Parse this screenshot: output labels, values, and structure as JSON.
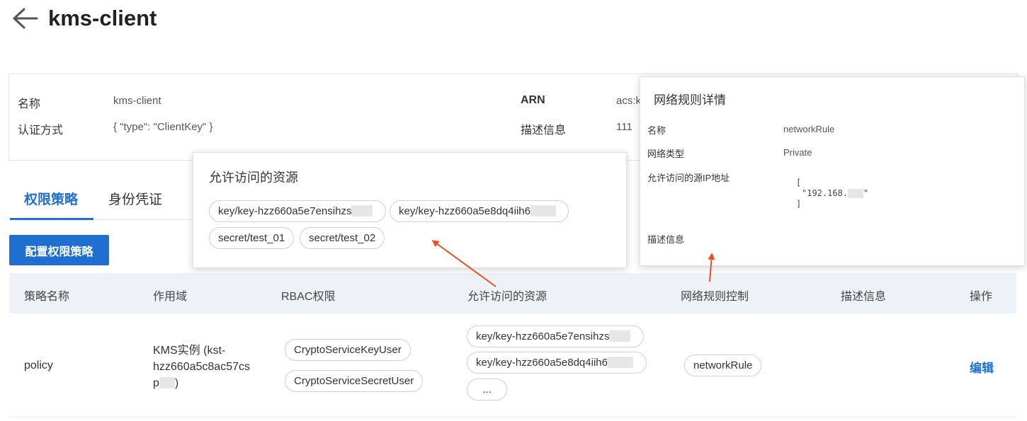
{
  "header": {
    "title": "kms-client"
  },
  "info": {
    "name_label": "名称",
    "name_value": "kms-client",
    "auth_label": "认证方式",
    "auth_value": "{ \"type\": \"ClientKey\" }",
    "arn_label": "ARN",
    "arn_value": "acs:k",
    "desc_label": "描述信息",
    "desc_value": "111"
  },
  "tabs": [
    {
      "label": "权限策略"
    },
    {
      "label": "身份凭证"
    }
  ],
  "config_button": "配置权限策略",
  "table": {
    "columns": [
      "策略名称",
      "作用域",
      "RBAC权限",
      "允许访问的资源",
      "网络规则控制",
      "描述信息",
      "操作"
    ],
    "row": {
      "policy_name": "policy",
      "scope_line1": "KMS实例 (kst-",
      "scope_line2": "hzz660a5c8ac57cs",
      "scope_line3_pre": "p",
      "scope_line3_post": ")",
      "rbac": [
        "CryptoServiceKeyUser",
        "CryptoServiceSecretUser"
      ],
      "resources": [
        "key/key-hzz660a5e7ensihzs",
        "key/key-hzz660a5e8dq4iih6",
        "..."
      ],
      "network_rule": "networkRule",
      "action": "编辑"
    }
  },
  "resource_popup": {
    "title": "允许访问的资源",
    "items": [
      "key/key-hzz660a5e7ensihzs",
      "key/key-hzz660a5e8dq4iih6",
      "secret/test_01",
      "secret/test_02"
    ]
  },
  "network_popup": {
    "title": "网络规则详情",
    "name_label": "名称",
    "name_value": "networkRule",
    "type_label": "网络类型",
    "type_value": "Private",
    "ip_label": "允许访问的源IP地址",
    "ip_open": "[",
    "ip_value": "\"192.168.",
    "ip_quote_close": "\"",
    "ip_close": "]",
    "desc_label": "描述信息"
  },
  "colors": {
    "accent": "#1f6fd1",
    "arrow": "#e8521e",
    "table_header": "#eef1f6"
  }
}
